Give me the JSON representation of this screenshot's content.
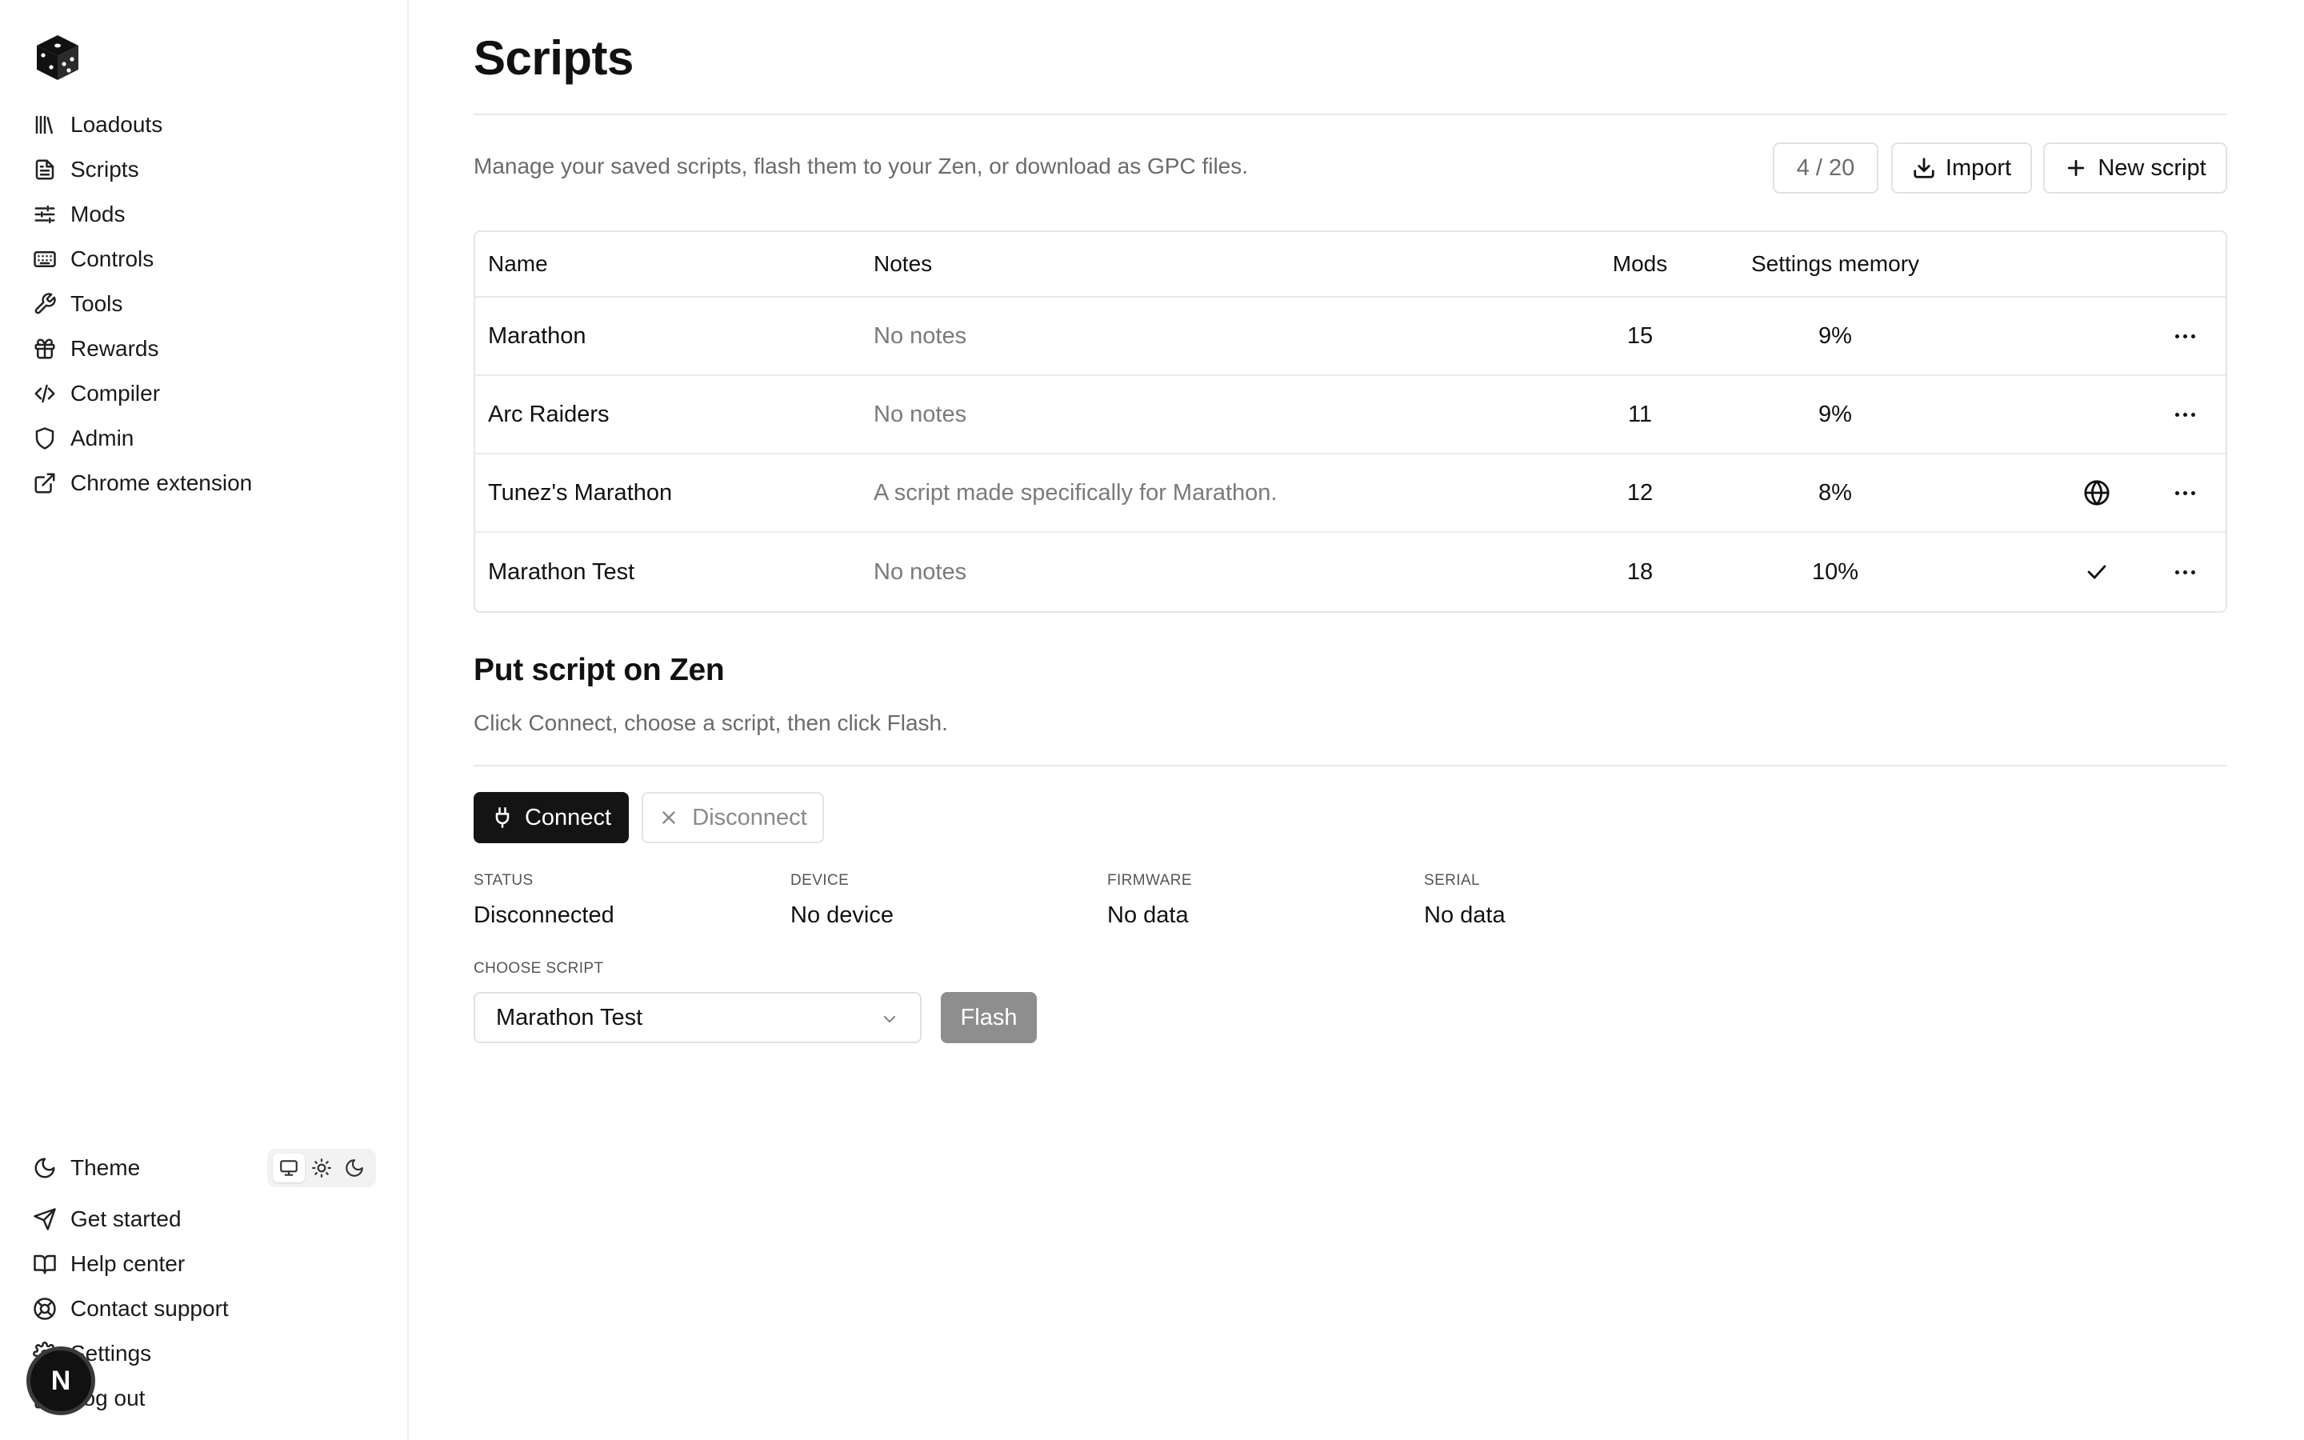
{
  "sidebar": {
    "logo_icon": "cube-logo-icon",
    "nav": [
      {
        "label": "Loadouts",
        "icon": "library-icon"
      },
      {
        "label": "Scripts",
        "icon": "file-text-icon"
      },
      {
        "label": "Mods",
        "icon": "sliders-icon"
      },
      {
        "label": "Controls",
        "icon": "keyboard-icon"
      },
      {
        "label": "Tools",
        "icon": "wrench-icon"
      },
      {
        "label": "Rewards",
        "icon": "gift-icon"
      },
      {
        "label": "Compiler",
        "icon": "code-icon"
      },
      {
        "label": "Admin",
        "icon": "shield-icon"
      },
      {
        "label": "Chrome extension",
        "icon": "external-link-icon"
      }
    ],
    "theme": {
      "label": "Theme",
      "options": [
        "monitor-icon",
        "sun-icon",
        "moon-icon"
      ],
      "selected": "system"
    },
    "footer": [
      {
        "label": "Get started",
        "icon": "send-icon"
      },
      {
        "label": "Help center",
        "icon": "book-open-icon"
      },
      {
        "label": "Contact support",
        "icon": "life-buoy-icon"
      },
      {
        "label": "Settings",
        "icon": "gear-icon"
      },
      {
        "label": "Log out",
        "icon": "log-out-icon"
      }
    ],
    "avatar": "N"
  },
  "header": {
    "title": "Scripts",
    "subtitle": "Manage your saved scripts, flash them to your Zen, or download as GPC files.",
    "counter": "4 / 20",
    "import_label": "Import",
    "new_label": "New script"
  },
  "table": {
    "columns": {
      "name": "Name",
      "notes": "Notes",
      "mods": "Mods",
      "memory": "Settings memory"
    },
    "rows": [
      {
        "name": "Marathon",
        "notes": "No notes",
        "mods": "15",
        "memory": "9%",
        "flag": ""
      },
      {
        "name": "Arc Raiders",
        "notes": "No notes",
        "mods": "11",
        "memory": "9%",
        "flag": ""
      },
      {
        "name": "Tunez's Marathon",
        "notes": "A script made specifically for Marathon.",
        "mods": "12",
        "memory": "8%",
        "flag": "globe-icon"
      },
      {
        "name": "Marathon Test",
        "notes": "No notes",
        "mods": "18",
        "memory": "10%",
        "flag": "check-icon"
      }
    ]
  },
  "flash": {
    "title": "Put script on Zen",
    "description": "Click Connect, choose a script, then click Flash.",
    "connect_label": "Connect",
    "disconnect_label": "Disconnect",
    "status_label": "STATUS",
    "status_value": "Disconnected",
    "device_label": "DEVICE",
    "device_value": "No device",
    "firmware_label": "FIRMWARE",
    "firmware_value": "No data",
    "serial_label": "SERIAL",
    "serial_value": "No data",
    "choose_label": "CHOOSE SCRIPT",
    "selected_script": "Marathon Test",
    "flash_label": "Flash"
  },
  "colors": {
    "primary_button": "#141414",
    "disabled_button": "#8e8e8e",
    "muted_text": "#6b6b6b",
    "border": "#e6e6e6"
  }
}
